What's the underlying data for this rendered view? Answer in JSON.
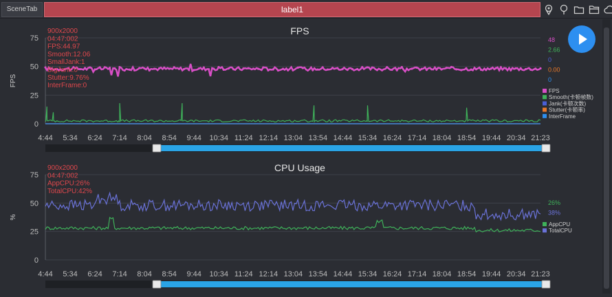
{
  "tabs": {
    "scene_tab": "SceneTab",
    "label_tab": "label1"
  },
  "icons": [
    "location-pin-icon",
    "map-marker-icon",
    "folder-icon",
    "open-folder-icon",
    "cloud-icon"
  ],
  "colors": {
    "fps": "#d94fc7",
    "smooth": "#3fb25a",
    "jank": "#4a5fd6",
    "stutter": "#e8782a",
    "interframe": "#2d8ff0",
    "app_cpu": "#3fb25a",
    "total_cpu": "#6a72d8",
    "info_text": "#e0474c",
    "slider": "#2aa4e6"
  },
  "x_ticks": [
    "4:44",
    "5:34",
    "6:24",
    "7:14",
    "8:04",
    "8:54",
    "9:44",
    "10:34",
    "11:24",
    "12:14",
    "13:04",
    "13:54",
    "14:44",
    "15:34",
    "16:24",
    "17:14",
    "18:04",
    "18:54",
    "19:44",
    "20:34",
    "21:23"
  ],
  "chart_data": [
    {
      "type": "line",
      "title": "FPS",
      "ylabel": "FPS",
      "ylim": [
        0,
        75
      ],
      "y_ticks": [
        "0",
        "25",
        "50",
        "75"
      ],
      "x_range": [
        "4:44",
        "21:23"
      ],
      "info": [
        "900x2000",
        "04:47:002",
        "FPS:44.97",
        "Smooth:12.06",
        "SmallJank:1",
        "BigJank:0",
        "Stutter:9.76%",
        "InterFrame:0"
      ],
      "legend_position": "right",
      "series": [
        {
          "name": "FPS",
          "current": "48",
          "baseline": 48,
          "color": "#d94fc7"
        },
        {
          "name": "Smooth(卡顿帧数)",
          "current": "2.66",
          "baseline": 2.5,
          "color": "#3fb25a"
        },
        {
          "name": "Jank(卡顿次数)",
          "current": "0",
          "baseline": 0,
          "color": "#4a5fd6"
        },
        {
          "name": "Stutter(卡顿率)",
          "current": "0.00",
          "baseline": 0,
          "color": "#e8782a"
        },
        {
          "name": "InterFrame",
          "current": "0",
          "baseline": 0,
          "color": "#2d8ff0"
        }
      ],
      "smooth_spikes": [
        {
          "x": "4:47",
          "y": 15
        },
        {
          "x": "5:00",
          "y": 10
        },
        {
          "x": "7:14",
          "y": 18
        },
        {
          "x": "9:20",
          "y": 18
        },
        {
          "x": "13:46",
          "y": 16
        },
        {
          "x": "15:34",
          "y": 16
        },
        {
          "x": "18:54",
          "y": 14
        }
      ]
    },
    {
      "type": "line",
      "title": "CPU Usage",
      "ylabel": "%",
      "ylim": [
        0,
        75
      ],
      "y_ticks": [
        "0",
        "25",
        "50",
        "75"
      ],
      "x_range": [
        "4:44",
        "21:23"
      ],
      "info": [
        "900x2000",
        "04:47:002",
        "AppCPU:26%",
        "TotalCPU:42%"
      ],
      "legend_position": "right",
      "series": [
        {
          "name": "AppCPU",
          "current": "26%",
          "baseline": 28,
          "color": "#3fb25a"
        },
        {
          "name": "TotalCPU",
          "current": "38%",
          "baseline": 48,
          "color": "#6a72d8"
        }
      ]
    }
  ]
}
